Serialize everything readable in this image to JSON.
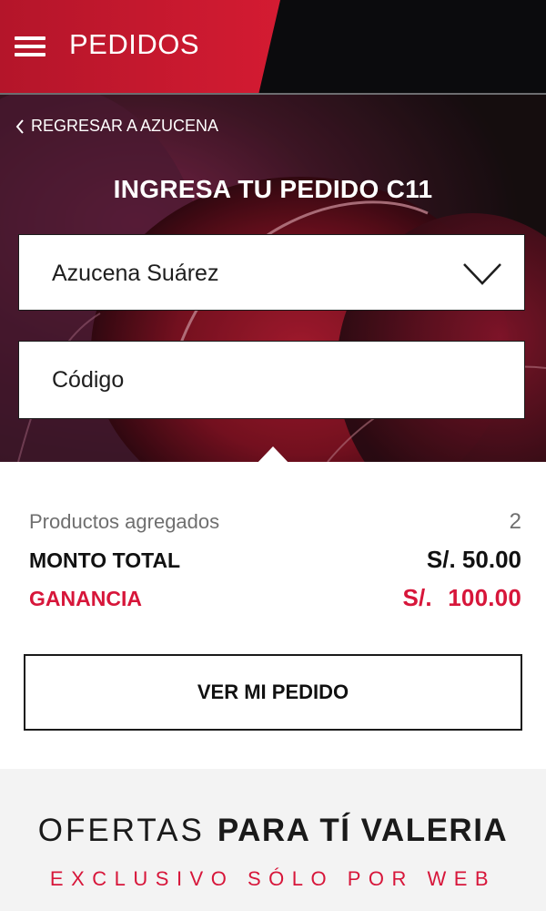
{
  "header": {
    "title": "PEDIDOS",
    "menu_icon": "hamburger-menu-icon",
    "brand_color": "#d91c33"
  },
  "hero": {
    "back_label": "REGRESAR A AZUCENA",
    "title": "INGRESA TU PEDIDO C11",
    "selected_client": "Azucena Suárez",
    "code_placeholder": "Código",
    "code_value": ""
  },
  "summary": {
    "products_label": "Productos agregados",
    "products_count": "2",
    "total_label": "MONTO TOTAL",
    "total_amount": "S/. 50.00",
    "gain_label": "GANANCIA",
    "gain_amount": "S/. 100.00",
    "order_button": "VER MI PEDIDO"
  },
  "offers": {
    "title_light": "OFERTAS",
    "title_bold": "PARA TÍ VALERIA",
    "subtitle": "EXCLUSIVO SÓLO POR WEB",
    "accent_color": "#d7163a"
  }
}
